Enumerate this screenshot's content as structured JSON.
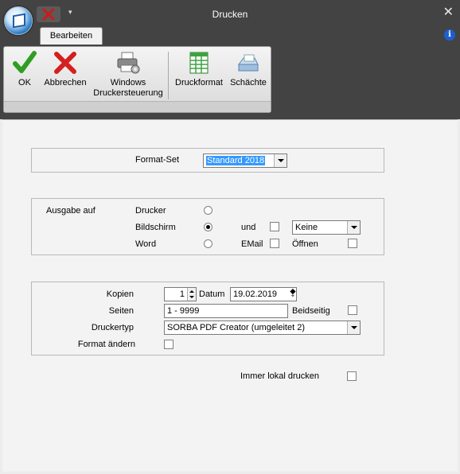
{
  "window": {
    "title": "Drucken"
  },
  "ribbon": {
    "tab": "Bearbeiten",
    "buttons": {
      "ok": "OK",
      "cancel": "Abbrechen",
      "win_line1": "Windows",
      "win_line2": "Druckersteuerung",
      "format": "Druckformat",
      "trays": "Schächte"
    }
  },
  "formatset": {
    "label": "Format-Set",
    "value": "Standard 2018"
  },
  "output": {
    "label": "Ausgabe auf",
    "printer": "Drucker",
    "screen": "Bildschirm",
    "word": "Word",
    "and": "und",
    "email": "EMail",
    "open": "Öffnen",
    "keine": "Keine",
    "selected": "Bildschirm"
  },
  "print": {
    "copies_label": "Kopien",
    "copies": "1",
    "date_label": "Datum",
    "date": "19.02.2019",
    "pages_label": "Seiten",
    "pages": "1 - 9999",
    "duplex_label": "Beidseitig",
    "printertype_label": "Druckertyp",
    "printertype": "SORBA PDF Creator (umgeleitet 2)",
    "change_format_label": "Format ändern"
  },
  "local": {
    "label": "Immer lokal drucken"
  },
  "colors": {
    "titlebar": "#434343",
    "highlight": "#3399ff",
    "info": "#1d5fcf"
  }
}
